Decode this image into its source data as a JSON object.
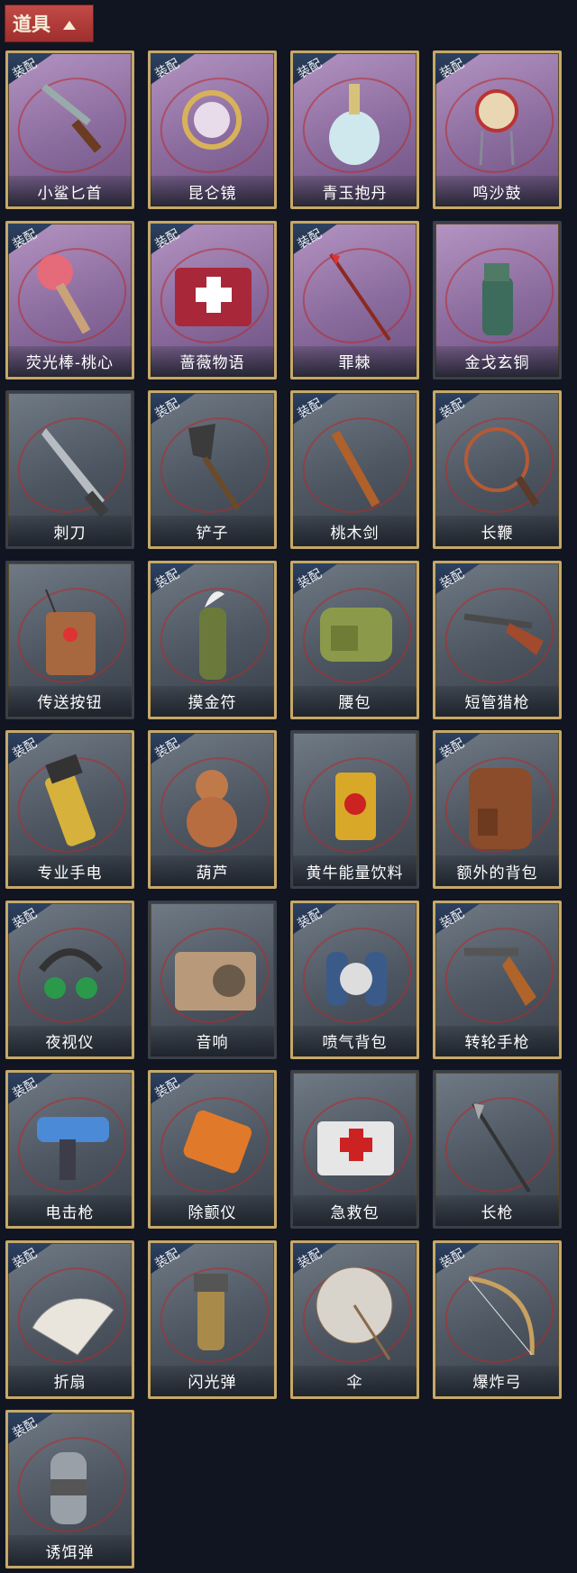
{
  "header": {
    "tab_label": "道具"
  },
  "equip_badge": "装配",
  "items": [
    {
      "label": "小鲨匕首",
      "equipped": true,
      "theme": "purple",
      "icon": "shark-dagger-icon",
      "art": "dagger"
    },
    {
      "label": "昆仑镜",
      "equipped": true,
      "theme": "purple",
      "icon": "kunlun-mirror-icon",
      "art": "mirror"
    },
    {
      "label": "青玉抱丹",
      "equipped": true,
      "theme": "purple",
      "icon": "jade-vase-icon",
      "art": "vase"
    },
    {
      "label": "鸣沙鼓",
      "equipped": true,
      "theme": "purple",
      "icon": "sand-drum-icon",
      "art": "drum"
    },
    {
      "label": "荧光棒-桃心",
      "equipped": true,
      "theme": "purple",
      "icon": "heart-glowstick-icon",
      "art": "glowstick"
    },
    {
      "label": "蔷薇物语",
      "equipped": true,
      "theme": "purple",
      "icon": "rose-medkit-icon",
      "art": "medkit-red"
    },
    {
      "label": "罪棘",
      "equipped": true,
      "theme": "purple",
      "icon": "thorn-spear-icon",
      "art": "spear-red"
    },
    {
      "label": "金戈玄铜",
      "equipped": false,
      "theme": "purple",
      "icon": "bronze-grenade-icon",
      "art": "grenade-green"
    },
    {
      "label": "刺刀",
      "equipped": false,
      "theme": "gray",
      "icon": "bayonet-icon",
      "art": "knife"
    },
    {
      "label": "铲子",
      "equipped": true,
      "theme": "gray",
      "icon": "shovel-icon",
      "art": "shovel"
    },
    {
      "label": "桃木剑",
      "equipped": true,
      "theme": "gray",
      "icon": "wooden-sword-icon",
      "art": "sword"
    },
    {
      "label": "长鞭",
      "equipped": true,
      "theme": "gray",
      "icon": "whip-icon",
      "art": "whip"
    },
    {
      "label": "传送按钮",
      "equipped": false,
      "theme": "gray",
      "icon": "teleport-button-icon",
      "art": "remote"
    },
    {
      "label": "摸金符",
      "equipped": true,
      "theme": "gray",
      "icon": "talisman-icon",
      "art": "talisman"
    },
    {
      "label": "腰包",
      "equipped": true,
      "theme": "gray",
      "icon": "waist-bag-icon",
      "art": "bag-green"
    },
    {
      "label": "短管猎枪",
      "equipped": true,
      "theme": "gray",
      "icon": "shotgun-icon",
      "art": "shotgun"
    },
    {
      "label": "专业手电",
      "equipped": true,
      "theme": "gray",
      "icon": "flashlight-icon",
      "art": "flashlight"
    },
    {
      "label": "葫芦",
      "equipped": true,
      "theme": "gray",
      "icon": "gourd-icon",
      "art": "gourd"
    },
    {
      "label": "黄牛能量饮料",
      "equipped": false,
      "theme": "gray",
      "icon": "energy-drink-icon",
      "art": "can"
    },
    {
      "label": "额外的背包",
      "equipped": true,
      "theme": "gray",
      "icon": "backpack-icon",
      "art": "backpack"
    },
    {
      "label": "夜视仪",
      "equipped": true,
      "theme": "gray",
      "icon": "night-vision-icon",
      "art": "goggles"
    },
    {
      "label": "音响",
      "equipped": false,
      "theme": "gray",
      "icon": "speaker-icon",
      "art": "radio"
    },
    {
      "label": "喷气背包",
      "equipped": true,
      "theme": "gray",
      "icon": "jetpack-icon",
      "art": "jetpack"
    },
    {
      "label": "转轮手枪",
      "equipped": true,
      "theme": "gray",
      "icon": "revolver-icon",
      "art": "revolver"
    },
    {
      "label": "电击枪",
      "equipped": true,
      "theme": "gray",
      "icon": "taser-icon",
      "art": "taser"
    },
    {
      "label": "除颤仪",
      "equipped": true,
      "theme": "gray",
      "icon": "defibrillator-icon",
      "art": "defib"
    },
    {
      "label": "急救包",
      "equipped": false,
      "theme": "gray",
      "icon": "first-aid-kit-icon",
      "art": "medkit-white"
    },
    {
      "label": "长枪",
      "equipped": false,
      "theme": "gray",
      "icon": "spear-icon",
      "art": "spear"
    },
    {
      "label": "折扇",
      "equipped": true,
      "theme": "gray",
      "icon": "folding-fan-icon",
      "art": "fan"
    },
    {
      "label": "闪光弹",
      "equipped": true,
      "theme": "gray",
      "icon": "flashbang-icon",
      "art": "flashbang"
    },
    {
      "label": "伞",
      "equipped": true,
      "theme": "gray",
      "icon": "umbrella-icon",
      "art": "umbrella"
    },
    {
      "label": "爆炸弓",
      "equipped": true,
      "theme": "gray",
      "icon": "explosive-bow-icon",
      "art": "bow"
    },
    {
      "label": "诱饵弹",
      "equipped": true,
      "theme": "gray",
      "icon": "decoy-grenade-icon",
      "art": "decoy"
    }
  ]
}
